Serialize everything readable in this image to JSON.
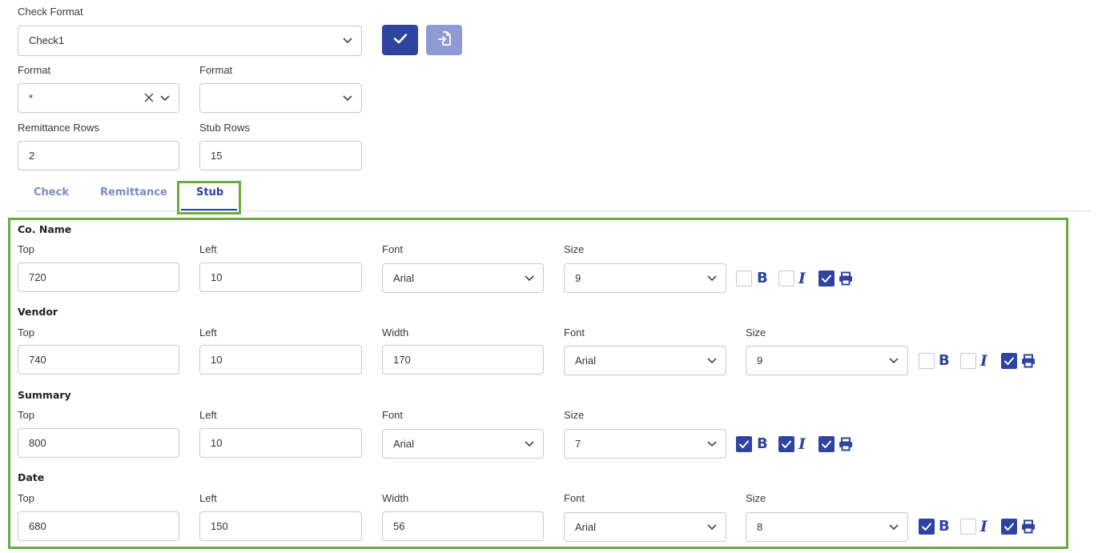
{
  "check_format": {
    "label": "Check Format",
    "value": "Check1"
  },
  "format1": {
    "label": "Format",
    "value": "*"
  },
  "format2": {
    "label": "Format",
    "value": ""
  },
  "remittance_rows": {
    "label": "Remittance Rows",
    "value": "2"
  },
  "stub_rows": {
    "label": "Stub Rows",
    "value": "15"
  },
  "tabs": [
    {
      "label": "Check"
    },
    {
      "label": "Remittance"
    },
    {
      "label": "Stub"
    }
  ],
  "sections": {
    "co_name": {
      "title": "Co. Name",
      "top_label": "Top",
      "top": "720",
      "left_label": "Left",
      "left": "10",
      "font_label": "Font",
      "font": "Arial",
      "size_label": "Size",
      "size": "9",
      "bold": false,
      "italic": false,
      "print": true
    },
    "vendor": {
      "title": "Vendor",
      "top_label": "Top",
      "top": "740",
      "left_label": "Left",
      "left": "10",
      "width_label": "Width",
      "width": "170",
      "font_label": "Font",
      "font": "Arial",
      "size_label": "Size",
      "size": "9",
      "bold": false,
      "italic": false,
      "print": true
    },
    "summary": {
      "title": "Summary",
      "top_label": "Top",
      "top": "800",
      "left_label": "Left",
      "left": "10",
      "font_label": "Font",
      "font": "Arial",
      "size_label": "Size",
      "size": "7",
      "bold": true,
      "italic": true,
      "print": true
    },
    "date": {
      "title": "Date",
      "top_label": "Top",
      "top": "680",
      "left_label": "Left",
      "left": "150",
      "width_label": "Width",
      "width": "56",
      "font_label": "Font",
      "font": "Arial",
      "size_label": "Size",
      "size": "8",
      "bold": true,
      "italic": false,
      "print": true
    }
  },
  "icons": {
    "bold": "B",
    "italic": "I"
  },
  "colors": {
    "primary": "#2e44a0",
    "primary_muted": "#8e9ad6",
    "tab_inactive": "#7b8cc6",
    "highlight": "#6aab3e"
  }
}
